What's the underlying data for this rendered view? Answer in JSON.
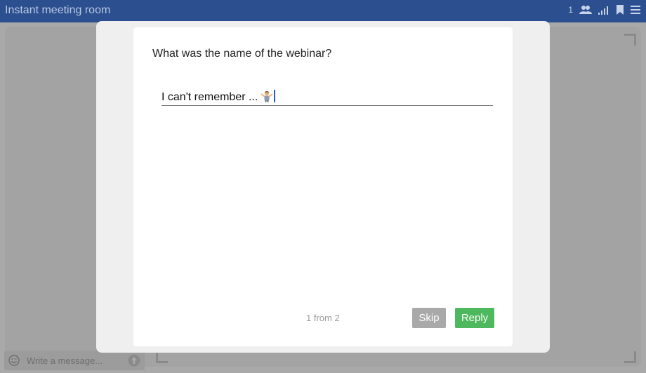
{
  "header": {
    "title": "Instant meeting room",
    "participants_count": "1",
    "icons": [
      "participants-icon",
      "signal-icon",
      "bookmark-icon",
      "menu-icon"
    ]
  },
  "chat": {
    "message_placeholder": "Write a message..."
  },
  "modal": {
    "question": "What was the name of the webinar?",
    "answer_text": "I can't remember ...",
    "answer_emoji_icon": "person-shrugging-icon",
    "pager": "1 from 2",
    "skip_label": "Skip",
    "reply_label": "Reply"
  },
  "colors": {
    "topbar": "#2c4f8f",
    "reply_button": "#4db85d",
    "skip_button": "#a9a9a9",
    "caret": "#2a5bd7"
  }
}
